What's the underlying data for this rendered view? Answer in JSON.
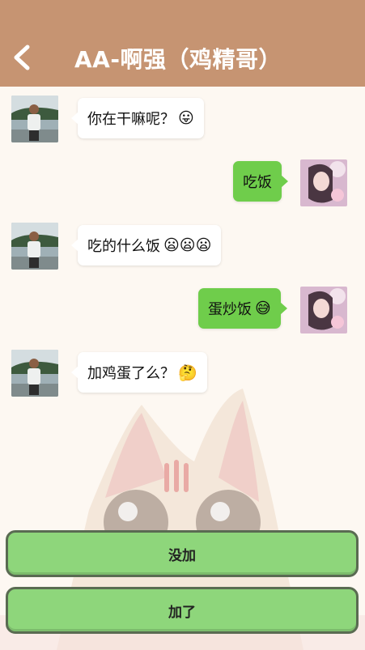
{
  "header": {
    "title": "AA-啊强（鸡精哥）",
    "back_icon": "chevron-left-icon",
    "color": "#c69472"
  },
  "messages": [
    {
      "side": "left",
      "text": "你在干嘛呢？",
      "emoji": "😛"
    },
    {
      "side": "right",
      "text": "吃饭",
      "emoji": ""
    },
    {
      "side": "left",
      "text": "吃的什么饭",
      "emoji": "😦😦😦"
    },
    {
      "side": "right",
      "text": "蛋炒饭",
      "emoji": "😅"
    },
    {
      "side": "left",
      "text": "加鸡蛋了么？",
      "emoji": "🤔"
    }
  ],
  "actions": {
    "option_1": "没加",
    "option_2": "加了"
  },
  "colors": {
    "incoming_bubble": "#ffffff",
    "outgoing_bubble": "#6fcd4b",
    "button": "#8ed67b",
    "background": "#fdf8f2"
  }
}
